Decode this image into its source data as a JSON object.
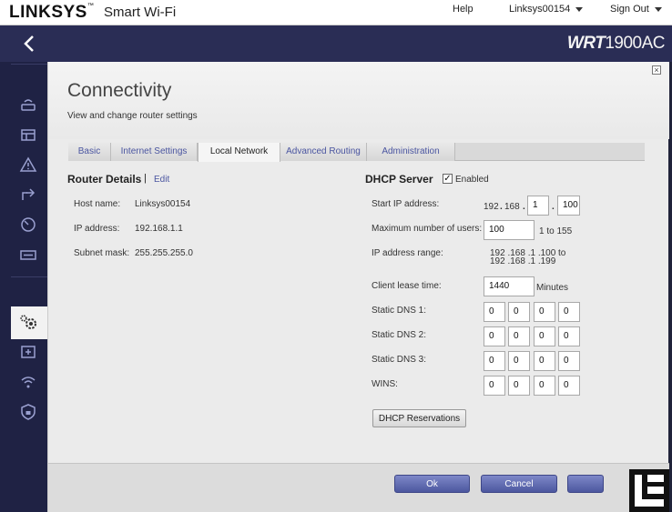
{
  "header": {
    "brand": "LINKSYS",
    "brand_tm": "™",
    "product": "Smart Wi-Fi",
    "help": "Help",
    "account": "Linksys00154",
    "sign_out": "Sign Out"
  },
  "band": {
    "model_prefix": "WRT",
    "model_number": "1900AC"
  },
  "sidebar": {
    "icons": [
      "router-icon",
      "devices-icon",
      "warning-icon",
      "media-prioritization-icon",
      "speed-test-icon",
      "usb-storage-icon",
      "connectivity-gear-icon",
      "troubleshooting-icon",
      "wireless-icon",
      "security-icon"
    ]
  },
  "page": {
    "title": "Connectivity",
    "subtitle": "View and change router settings"
  },
  "tabs": [
    {
      "label": "Basic"
    },
    {
      "label": "Internet Settings"
    },
    {
      "label": "Local Network"
    },
    {
      "label": "Advanced Routing"
    },
    {
      "label": "Administration"
    }
  ],
  "router_details": {
    "title": "Router Details",
    "separator": "|",
    "edit": "Edit",
    "host_name_label": "Host name:",
    "host_name": "Linksys00154",
    "ip_label": "IP address:",
    "ip": "192.168.1.1",
    "subnet_label": "Subnet mask:",
    "subnet": "255.255.255.0"
  },
  "dhcp": {
    "title": "DHCP Server",
    "enabled_label": "Enabled",
    "start_ip_label": "Start IP address:",
    "start_ip_prefix1": "192",
    "start_ip_prefix2": "168",
    "start_ip_octet3": "1",
    "start_ip_octet4": "100",
    "max_users_label": "Maximum number of users:",
    "max_users": "100",
    "max_users_range": "1 to 155",
    "range_label": "IP address range:",
    "range_start": "192 .168 .1 .100",
    "range_to": "to",
    "range_end": "192 .168 .1 .199",
    "lease_label": "Client lease time:",
    "lease_value": "1440",
    "lease_unit": "Minutes",
    "dns1_label": "Static DNS 1:",
    "dns2_label": "Static DNS 2:",
    "dns3_label": "Static DNS 3:",
    "wins_label": "WINS:",
    "dns1": [
      "0",
      "0",
      "0",
      "0"
    ],
    "dns2": [
      "0",
      "0",
      "0",
      "0"
    ],
    "dns3": [
      "0",
      "0",
      "0",
      "0"
    ],
    "wins": [
      "0",
      "0",
      "0",
      "0"
    ],
    "reservations_button": "DHCP Reservations"
  },
  "footer": {
    "ok": "Ok",
    "cancel": "Cancel"
  },
  "colors": {
    "navy": "#2a2d55",
    "sidebar": "#1f2244",
    "link": "#4a55a0",
    "button": "#5a64ad"
  }
}
